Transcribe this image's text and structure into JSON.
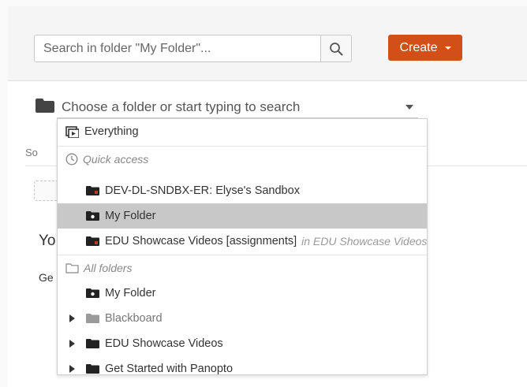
{
  "search": {
    "placeholder": "Search in folder \"My Folder\"..."
  },
  "create_button": {
    "label": "Create"
  },
  "folder_picker": {
    "placeholder": "Choose a folder or start typing to search"
  },
  "background": {
    "tab_fragment": "So",
    "heading_fragment": "Yo",
    "text_fragment": "Ge"
  },
  "dropdown": {
    "everything_label": "Everything",
    "quick_access_header": "Quick access",
    "quick_access": [
      {
        "label": "DEV-DL-SNDBX-ER: Elyse's Sandbox",
        "suffix": ""
      },
      {
        "label": "My Folder",
        "suffix": "",
        "selected": true
      },
      {
        "label": "EDU Showcase Videos [assignments]",
        "suffix": "in EDU Showcase Videos"
      }
    ],
    "all_folders_header": "All folders",
    "all_folders": [
      {
        "label": "My Folder",
        "expandable": false
      },
      {
        "label": "Blackboard",
        "expandable": true
      },
      {
        "label": "EDU Showcase Videos",
        "expandable": true
      },
      {
        "label": "Get Started with Panopto",
        "expandable": true
      }
    ]
  },
  "colors": {
    "accent": "#d24f18",
    "selected_row": "#c8c8c8",
    "folder_dark": "#222222",
    "folder_gray": "#9a9a9a",
    "folder_badge_red": "#c0392b"
  },
  "icons": {
    "search": "search-icon",
    "create_caret": "caret-down-icon",
    "folder": "folder-icon",
    "everything": "everything-icon",
    "quick_access": "clock-icon",
    "all_folders": "folder-outline-icon",
    "expander": "triangle-right-icon"
  }
}
